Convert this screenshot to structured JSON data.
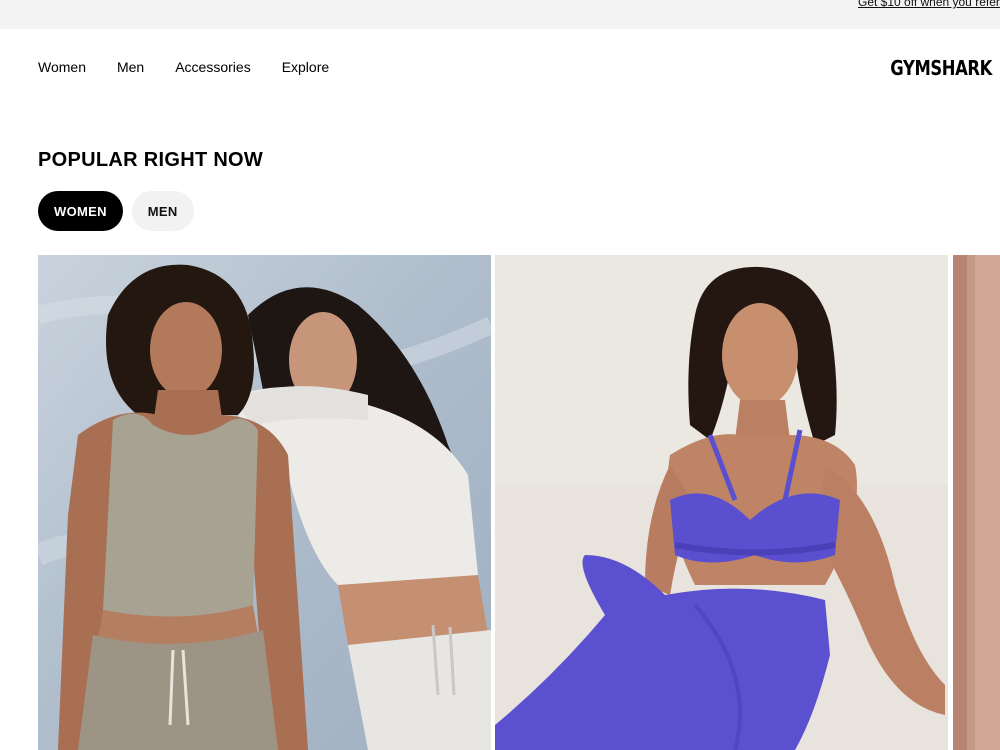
{
  "promo": {
    "text": "Get $10 off when you refer"
  },
  "nav": {
    "items": [
      {
        "label": "Women"
      },
      {
        "label": "Men"
      },
      {
        "label": "Accessories"
      },
      {
        "label": "Explore"
      }
    ]
  },
  "brand": {
    "logo": "GYMSHARK"
  },
  "popular": {
    "title": "POPULAR RIGHT NOW",
    "tabs": [
      {
        "label": "WOMEN",
        "active": true
      },
      {
        "label": "MEN",
        "active": false
      }
    ]
  },
  "products": [
    {
      "image": "two-models-neutral-tops-joggers"
    },
    {
      "image": "model-blue-sports-bra-leggings"
    },
    {
      "image": "partial-product-image"
    }
  ],
  "colors": {
    "accent": "#000000",
    "promo_bg": "#f3f3f3",
    "pill_inactive_bg": "#f2f2f2",
    "outfit_blue": "#5a4fcf"
  }
}
